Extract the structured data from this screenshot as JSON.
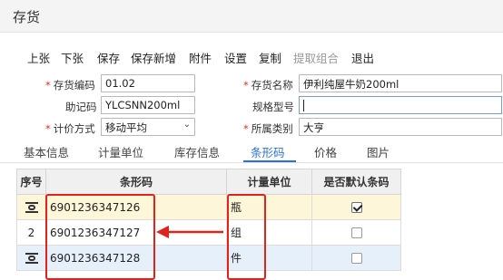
{
  "window": {
    "title": "存货"
  },
  "toolbar": {
    "prev": "上张",
    "next": "下张",
    "save": "保存",
    "save_new": "保存新增",
    "attachment": "附件",
    "settings": "设置",
    "copy": "复制",
    "extract_combo": "提取组合",
    "exit": "退出"
  },
  "form": {
    "code_label": "存货编码",
    "code_value": "01.02",
    "name_label": "存货名称",
    "name_value": "伊利纯屋牛奶200ml",
    "mnemonic_label": "助记码",
    "mnemonic_value": "YLCSNN200ml",
    "spec_label": "规格型号",
    "spec_value": "",
    "valuation_label": "计价方式",
    "valuation_value": "移动平均",
    "category_label": "所属类别",
    "category_value": "大亨"
  },
  "tabs": [
    "基本信息",
    "计量单位",
    "库存信息",
    "条形码",
    "价格",
    "图片"
  ],
  "active_tab": "条形码",
  "grid": {
    "headers": {
      "no": "序号",
      "barcode": "条形码",
      "unit": "计量单位",
      "default": "是否默认条码"
    },
    "rows": [
      {
        "no": "",
        "no_icon": "row-edit-icon",
        "barcode": "6901236347126",
        "unit": "瓶",
        "default": true
      },
      {
        "no": "2",
        "no_icon": "",
        "barcode": "6901236347127",
        "unit": "组",
        "default": false
      },
      {
        "no": "",
        "no_icon": "row-edit-icon",
        "barcode": "6901236347128",
        "unit": "件",
        "default": false
      }
    ]
  },
  "colors": {
    "accent": "#2a73d9",
    "annotation": "#e0231b",
    "required": "#d9381e",
    "row_selected": "#fdf6d8",
    "row_alt": "#e6f0fb"
  }
}
